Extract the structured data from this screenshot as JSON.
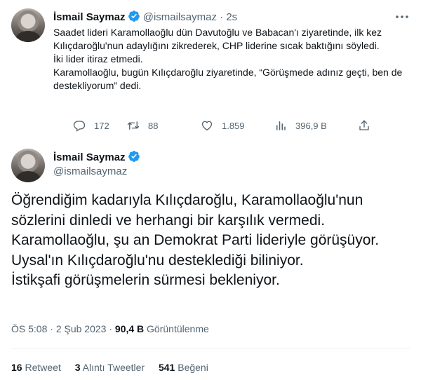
{
  "tweet1": {
    "name": "İsmail Saymaz",
    "handle": "@ismailsaymaz",
    "separator": "·",
    "time": "2s",
    "paragraphs": [
      "Saadet lideri Karamollaoğlu dün Davutoğlu ve Babacan'ı ziyaretinde, ilk kez Kılıçdaroğlu'nun adaylığını zikrederek, CHP liderine sıcak baktığını söyledi.",
      "İki lider itiraz etmedi.",
      "Karamollaoğlu, bugün Kılıçdaroğlu ziyaretinde, “Görüşmede adınız geçti, ben de destekliyorum” dedi."
    ],
    "actions": {
      "replies": "172",
      "retweets": "88",
      "likes": "1.859",
      "views": "396,9 B"
    }
  },
  "tweet2": {
    "name": "İsmail Saymaz",
    "handle": "@ismailsaymaz",
    "paragraphs": [
      "Öğrendiğim kadarıyla Kılıçdaroğlu, Karamollaoğlu'nun sözlerini dinledi ve herhangi bir karşılık vermedi.",
      "Karamollaoğlu, şu an Demokrat Parti lideriyle görüşüyor. Uysal'ın Kılıçdaroğlu'nu desteklediği biliniyor.",
      "İstikşafi görüşmelerin sürmesi bekleniyor."
    ],
    "meta": {
      "time": "ÖS 5:08",
      "separator": "·",
      "date": "2 Şub 2023",
      "views_count": "90,4 B",
      "views_label": "Görüntülenme"
    },
    "stats": {
      "retweets_count": "16",
      "retweets_label": "Retweet",
      "quotes_count": "3",
      "quotes_label": "Alıntı Tweetler",
      "likes_count": "541",
      "likes_label": "Beğeni"
    }
  },
  "colors": {
    "verified": "#1d9bf0",
    "text": "#0f1419",
    "muted": "#536471",
    "divider": "#eff3f4"
  }
}
